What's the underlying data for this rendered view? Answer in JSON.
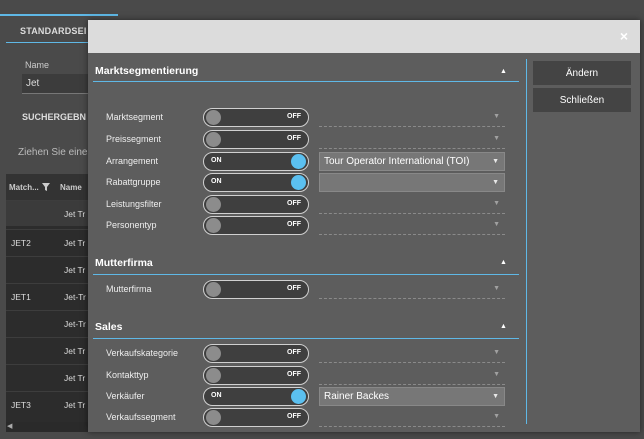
{
  "background": {
    "tab_label": "STANDARDSEI",
    "name_label": "Name",
    "name_value": "Jet",
    "results_label": "SUCHERGEBN",
    "hint_text": "Ziehen Sie einer",
    "table": {
      "headers": [
        "Match...",
        "Name"
      ],
      "rows": [
        {
          "match": "",
          "name": "Jet Tr"
        },
        {
          "match": "JET2",
          "name": "Jet Tr"
        },
        {
          "match": "",
          "name": "Jet Tr"
        },
        {
          "match": "JET1",
          "name": "Jet-Tr"
        },
        {
          "match": "",
          "name": "Jet-Tr"
        },
        {
          "match": "",
          "name": "Jet Tr"
        },
        {
          "match": "",
          "name": "Jet Tr"
        },
        {
          "match": "JET3",
          "name": "Jet Tr"
        }
      ]
    }
  },
  "modal": {
    "close_label": "×",
    "buttons": {
      "change": "Ändern",
      "close": "Schließen"
    },
    "sections": [
      {
        "title": "Marktsegmentierung",
        "rows": [
          {
            "label": "Marktsegment",
            "toggle": "OFF",
            "value": ""
          },
          {
            "label": "Preissegment",
            "toggle": "OFF",
            "value": ""
          },
          {
            "label": "Arrangement",
            "toggle": "ON",
            "value": "Tour Operator International (TOI)"
          },
          {
            "label": "Rabattgruppe",
            "toggle": "ON",
            "value": ""
          },
          {
            "label": "Leistungsfilter",
            "toggle": "OFF",
            "value": ""
          },
          {
            "label": "Personentyp",
            "toggle": "OFF",
            "value": ""
          }
        ]
      },
      {
        "title": "Mutterfirma",
        "rows": [
          {
            "label": "Mutterfirma",
            "toggle": "OFF",
            "value": ""
          }
        ]
      },
      {
        "title": "Sales",
        "rows": [
          {
            "label": "Verkaufskategorie",
            "toggle": "OFF",
            "value": ""
          },
          {
            "label": "Kontakttyp",
            "toggle": "OFF",
            "value": ""
          },
          {
            "label": "Verkäufer",
            "toggle": "ON",
            "value": "Rainer Backes"
          },
          {
            "label": "Verkaufssegment",
            "toggle": "OFF",
            "value": ""
          }
        ]
      }
    ]
  },
  "colors": {
    "accent": "#5fb8e6",
    "knob_on": "#5bc0f0",
    "header": "#dcdcdc"
  }
}
